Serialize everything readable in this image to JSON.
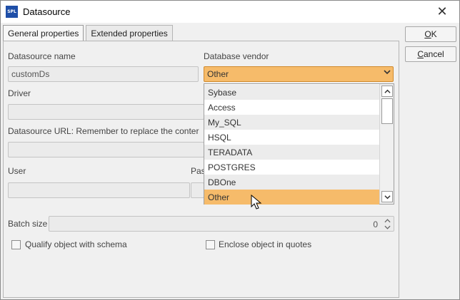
{
  "window": {
    "app_icon": "SPL",
    "title": "Datasource",
    "close_icon": "✕"
  },
  "tabs": [
    {
      "label": "General properties",
      "active": true
    },
    {
      "label": "Extended properties",
      "active": false
    }
  ],
  "buttons": {
    "ok": {
      "mnemonic": "O",
      "rest": "K"
    },
    "cancel": {
      "mnemonic": "C",
      "rest": "ancel"
    }
  },
  "form": {
    "datasource_name_label": "Datasource name",
    "datasource_name_value": "customDs",
    "database_vendor_label": "Database vendor",
    "database_vendor_value": "Other",
    "driver_label": "Driver",
    "driver_value": "",
    "url_label": "Datasource URL: Remember to replace the conter",
    "url_value": "",
    "user_label": "User",
    "password_label_partial": "Pas",
    "batch_size_label": "Batch size",
    "batch_size_value": "0",
    "qualify_label": "Qualify object with schema",
    "qualify_checked": false,
    "enclose_label": "Enclose object in quotes",
    "enclose_checked": false
  },
  "vendor_dropdown": {
    "options": [
      "Sybase",
      "Access",
      "My_SQL",
      "HSQL",
      "TERADATA",
      "POSTGRES",
      "DBOne",
      "Other"
    ],
    "selected": "Other",
    "highlight_color": "#f6bb6a"
  },
  "icons": {
    "dropdown_arrow": "chevron-down-icon",
    "scroll_up": "chevron-up-icon",
    "scroll_down": "chevron-down-icon",
    "cursor": "mouse-pointer-icon"
  }
}
